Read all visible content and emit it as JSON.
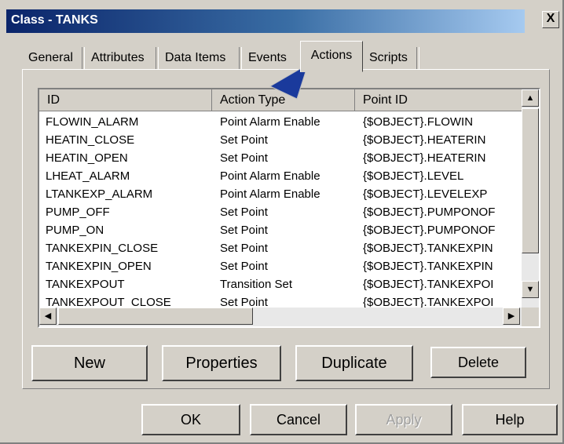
{
  "window": {
    "title": "Class - TANKS",
    "close_label": "X"
  },
  "tabs": [
    "General",
    "Attributes",
    "Data Items",
    "Events",
    "Actions",
    "Scripts"
  ],
  "active_tab": "Actions",
  "table": {
    "columns": [
      "ID",
      "Action Type",
      "Point ID"
    ],
    "rows": [
      [
        "FLOWIN_ALARM",
        "Point Alarm Enable",
        "{$OBJECT}.FLOWIN"
      ],
      [
        "HEATIN_CLOSE",
        "Set Point",
        "{$OBJECT}.HEATERIN"
      ],
      [
        "HEATIN_OPEN",
        "Set Point",
        "{$OBJECT}.HEATERIN"
      ],
      [
        "LHEAT_ALARM",
        "Point Alarm Enable",
        "{$OBJECT}.LEVEL"
      ],
      [
        "LTANKEXP_ALARM",
        "Point Alarm Enable",
        "{$OBJECT}.LEVELEXP"
      ],
      [
        "PUMP_OFF",
        "Set Point",
        "{$OBJECT}.PUMPONOF"
      ],
      [
        "PUMP_ON",
        "Set Point",
        "{$OBJECT}.PUMPONOF"
      ],
      [
        "TANKEXPIN_CLOSE",
        "Set Point",
        "{$OBJECT}.TANKEXPIN"
      ],
      [
        "TANKEXPIN_OPEN",
        "Set Point",
        "{$OBJECT}.TANKEXPIN"
      ],
      [
        "TANKEXPOUT",
        "Transition Set",
        "{$OBJECT}.TANKEXPOI"
      ],
      [
        "TANKEXPOUT_CLOSE",
        "Set Point",
        "{$OBJECT}.TANKEXPOI"
      ]
    ]
  },
  "actions": {
    "new": "New",
    "properties": "Properties",
    "duplicate": "Duplicate",
    "delete": "Delete"
  },
  "footer": {
    "ok": "OK",
    "cancel": "Cancel",
    "apply": "Apply",
    "help": "Help"
  },
  "icons": {
    "close": "close-icon",
    "scroll_up": "arrow-up-icon",
    "scroll_down": "arrow-down-icon",
    "scroll_left": "arrow-left-icon",
    "scroll_right": "arrow-right-icon",
    "pointer": "pointer-arrow-icon"
  },
  "colors": {
    "titlebar_start": "#0a246a",
    "titlebar_end": "#a6caf0",
    "face": "#d4d0c8",
    "pointer": "#1a3a9c"
  }
}
